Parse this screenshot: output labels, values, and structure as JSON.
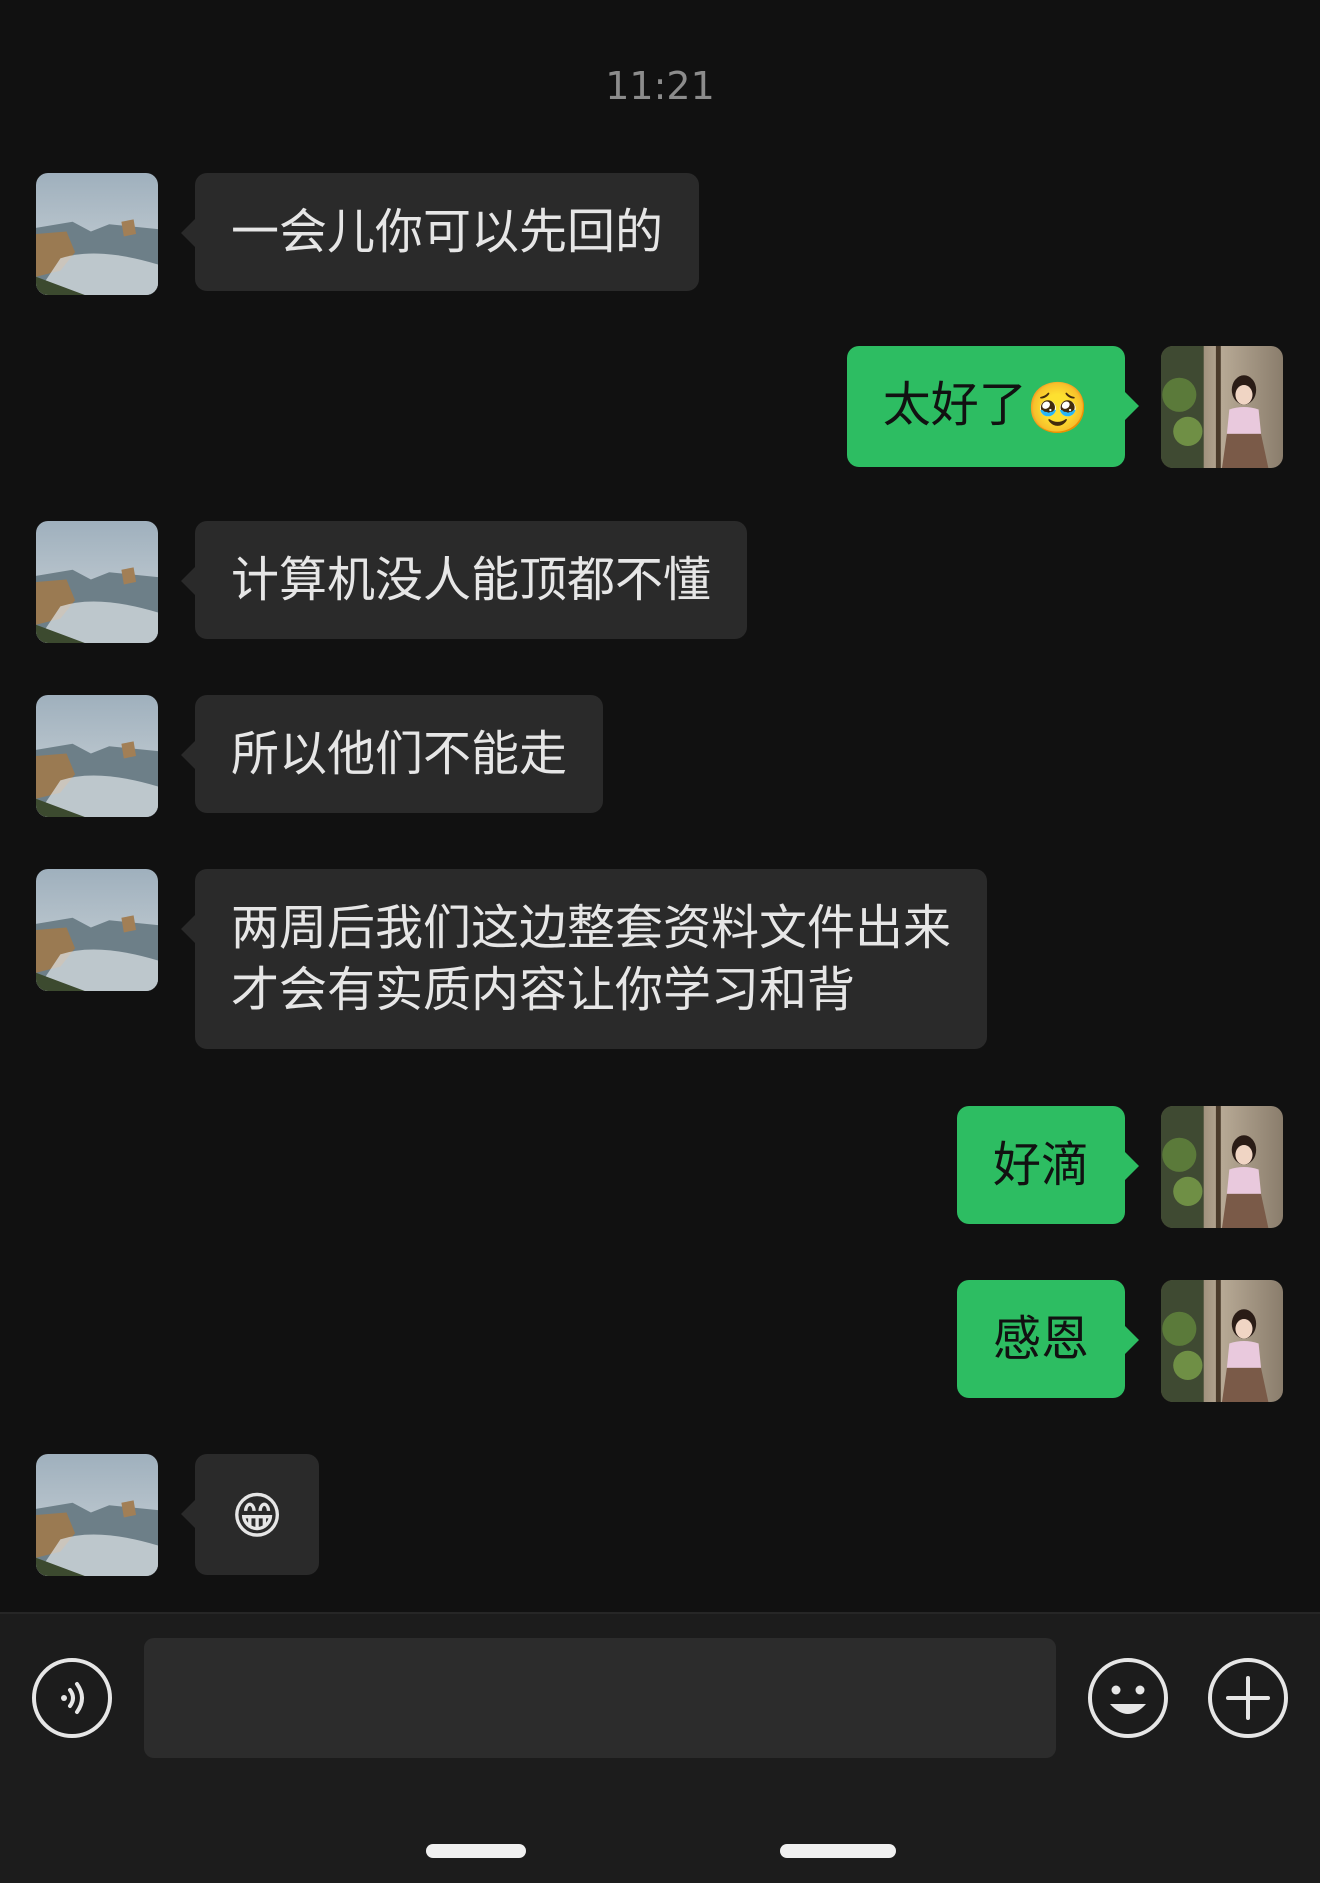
{
  "chat": {
    "timestamp": "11:21",
    "messages": [
      {
        "side": "in",
        "text": "一会儿你可以先回的"
      },
      {
        "side": "out",
        "text": "太好了",
        "emoji": "🥹"
      },
      {
        "side": "in",
        "text": "计算机没人能顶都不懂"
      },
      {
        "side": "in",
        "text": "所以他们不能走"
      },
      {
        "side": "in",
        "text": "两周后我们这边整套资料文件出来\n才会有实质内容让你学习和背"
      },
      {
        "side": "out",
        "text": "好滴"
      },
      {
        "side": "out",
        "text": "感恩"
      },
      {
        "side": "in",
        "text": "",
        "emoji": "😁"
      }
    ]
  },
  "input_bar": {
    "text_value": "",
    "voice_icon": "voice-icon",
    "emoji_icon": "emoji-icon",
    "plus_icon": "plus-icon"
  },
  "colors": {
    "background": "#111111",
    "incoming_bubble": "#2a2a2a",
    "outgoing_bubble": "#2dbd62",
    "timestamp": "#8c8c8c"
  }
}
